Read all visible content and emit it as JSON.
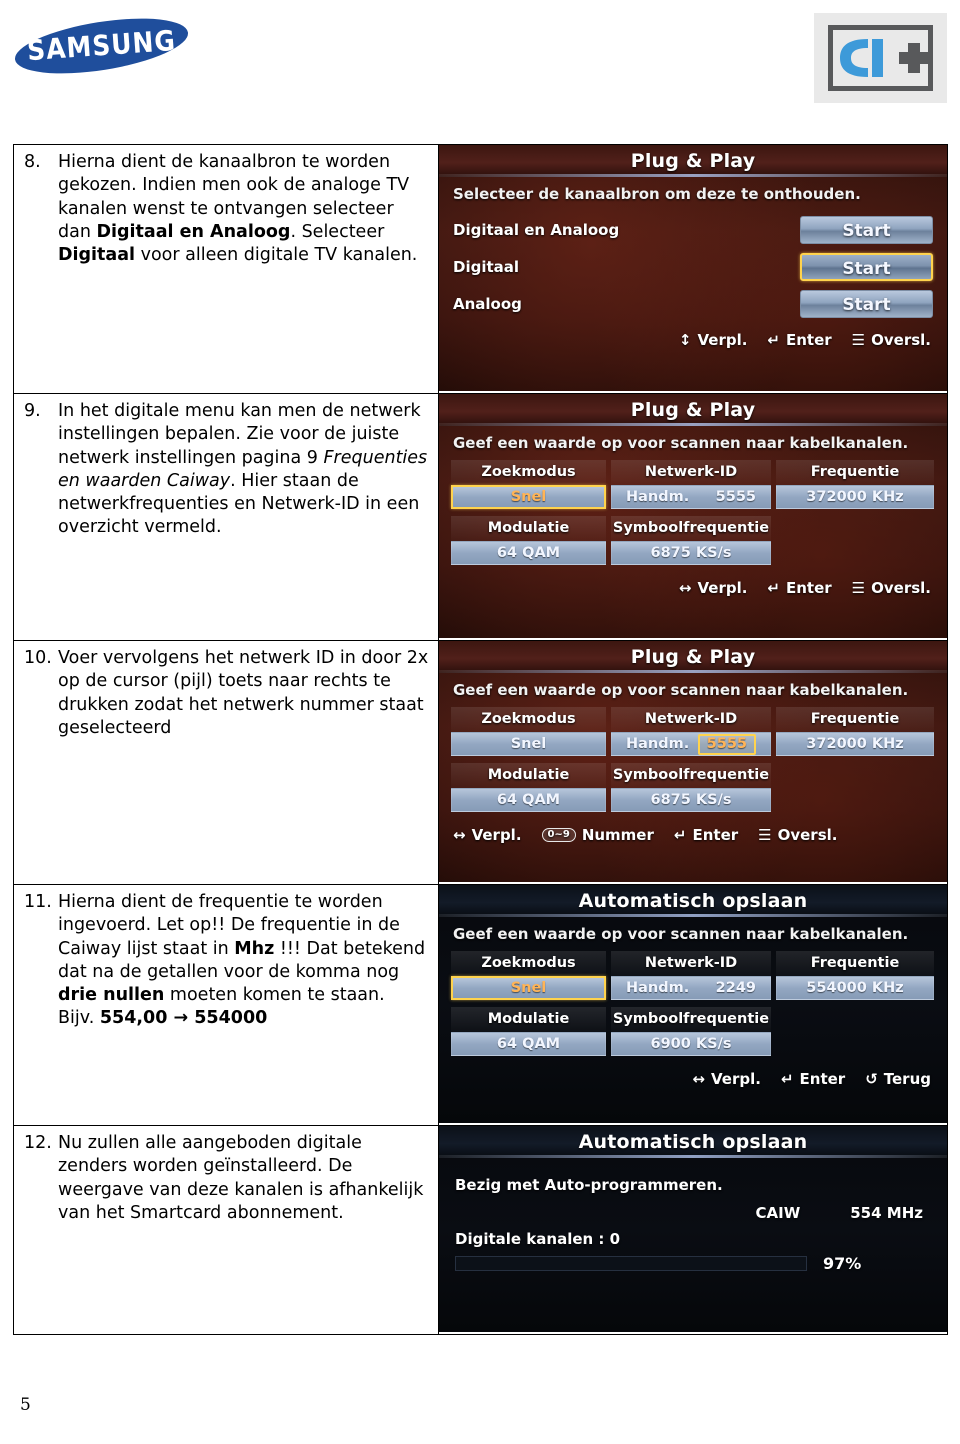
{
  "header": {
    "brand_logo": "samsung-logo",
    "brand_text": "SAMSUNG",
    "certification_logo": "ci-plus-logo",
    "certification_text": "CI+"
  },
  "page_number": "5",
  "steps": [
    {
      "number": "8.",
      "text_parts": [
        {
          "t": "Hierna dient de kanaalbron te worden gekozen. Indien men ook de analoge TV kanalen wenst te ontvangen selecteer dan ",
          "style": "normal"
        },
        {
          "t": "Digitaal en Analoog",
          "style": "bold"
        },
        {
          "t": ". Selecteer ",
          "style": "normal"
        },
        {
          "t": "Digitaal",
          "style": "bold"
        },
        {
          "t": " voor alleen digitale TV kanalen.",
          "style": "normal"
        }
      ]
    },
    {
      "number": "9.",
      "text_parts": [
        {
          "t": "In het digitale menu kan men de netwerk instellingen bepalen. Zie voor de juiste netwerk instellingen pagina 9 ",
          "style": "normal"
        },
        {
          "t": "Frequenties en waarden Caiway",
          "style": "italic"
        },
        {
          "t": ". Hier staan de netwerkfrequenties en Netwerk-ID in een overzicht vermeld.",
          "style": "normal"
        }
      ]
    },
    {
      "number": "10.",
      "text_parts": [
        {
          "t": "Voer vervolgens het netwerk ID in door 2x op de cursor (pijl) toets naar rechts te drukken zodat het netwerk nummer staat geselecteerd",
          "style": "normal"
        }
      ]
    },
    {
      "number": "11.",
      "text_parts": [
        {
          "t": "Hierna dient de frequentie te worden ingevoerd. Let op!! De frequentie in de Caiway lijst staat in ",
          "style": "normal"
        },
        {
          "t": "Mhz",
          "style": "bold"
        },
        {
          "t": " !!! Dat betekend dat na de getallen voor de komma nog ",
          "style": "normal"
        },
        {
          "t": "drie nullen",
          "style": "bold"
        },
        {
          "t": " moeten komen te staan.",
          "style": "normal"
        },
        {
          "t": "\nBijv. ",
          "style": "normal"
        },
        {
          "t": "554,00 → 554000",
          "style": "bold"
        }
      ]
    },
    {
      "number": "12.",
      "text_parts": [
        {
          "t": "Nu zullen alle aangeboden digitale zenders worden geïnstalleerd. De weergave van deze kanalen is afhankelijk van het Smartcard abonnement.",
          "style": "normal"
        }
      ]
    }
  ],
  "screens": [
    {
      "id": "plug-play-source",
      "title": "Plug & Play",
      "subtitle": "Selecteer de kanaalbron om deze te onthouden.",
      "options": [
        {
          "label": "Digitaal en Analoog",
          "button": "Start",
          "selected": false
        },
        {
          "label": "Digitaal",
          "button": "Start",
          "selected": true
        },
        {
          "label": "Analoog",
          "button": "Start",
          "selected": false
        }
      ],
      "hints": [
        {
          "icon": "up-down-arrow-icon",
          "glyph": "↕",
          "label": "Verpl."
        },
        {
          "icon": "enter-key-icon",
          "glyph": "↵",
          "label": "Enter"
        },
        {
          "icon": "exit-icon",
          "glyph": "☰",
          "label": "Oversl."
        }
      ]
    },
    {
      "id": "plug-play-values-1",
      "title": "Plug & Play",
      "subtitle": "Geef een waarde op voor scannen naar kabelkanalen.",
      "fields": {
        "zoekmodus_label": "Zoekmodus",
        "zoekmodus_value": "Snel",
        "netwerk_id_label": "Netwerk-ID",
        "netwerk_id_mode": "Handm.",
        "netwerk_id_value": "5555",
        "frequentie_label": "Frequentie",
        "frequentie_value": "372000 KHz",
        "modulatie_label": "Modulatie",
        "modulatie_value": "64  QAM",
        "symbool_label": "Symboolfrequentie",
        "symbool_value": "6875 KS/s"
      },
      "highlight": "zoekmodus",
      "hints": [
        {
          "icon": "left-right-arrow-icon",
          "glyph": "↔",
          "label": "Verpl."
        },
        {
          "icon": "enter-key-icon",
          "glyph": "↵",
          "label": "Enter"
        },
        {
          "icon": "exit-icon",
          "glyph": "☰",
          "label": "Oversl."
        }
      ]
    },
    {
      "id": "plug-play-values-2",
      "title": "Plug & Play",
      "subtitle": "Geef een waarde op voor scannen naar kabelkanalen.",
      "fields": {
        "zoekmodus_label": "Zoekmodus",
        "zoekmodus_value": "Snel",
        "netwerk_id_label": "Netwerk-ID",
        "netwerk_id_mode": "Handm.",
        "netwerk_id_value": "5555",
        "frequentie_label": "Frequentie",
        "frequentie_value": "372000 KHz",
        "modulatie_label": "Modulatie",
        "modulatie_value": "64  QAM",
        "symbool_label": "Symboolfrequentie",
        "symbool_value": "6875 KS/s"
      },
      "highlight": "netwerk-id-number",
      "hints": [
        {
          "icon": "left-right-arrow-icon",
          "glyph": "↔",
          "label": "Verpl."
        },
        {
          "icon": "number-keys-icon",
          "glyph": "0~9",
          "label": "Nummer"
        },
        {
          "icon": "enter-key-icon",
          "glyph": "↵",
          "label": "Enter"
        },
        {
          "icon": "exit-icon",
          "glyph": "☰",
          "label": "Oversl."
        }
      ]
    },
    {
      "id": "auto-store-values",
      "title": "Automatisch opslaan",
      "subtitle": "Geef een waarde op voor scannen naar kabelkanalen.",
      "fields": {
        "zoekmodus_label": "Zoekmodus",
        "zoekmodus_value": "Snel",
        "netwerk_id_label": "Netwerk-ID",
        "netwerk_id_mode": "Handm.",
        "netwerk_id_value": "2249",
        "frequentie_label": "Frequentie",
        "frequentie_value": "554000 KHz",
        "modulatie_label": "Modulatie",
        "modulatie_value": "64  QAM",
        "symbool_label": "Symboolfrequentie",
        "symbool_value": "6900 KS/s"
      },
      "highlight": "zoekmodus",
      "hints": [
        {
          "icon": "left-right-arrow-icon",
          "glyph": "↔",
          "label": "Verpl."
        },
        {
          "icon": "enter-key-icon",
          "glyph": "↵",
          "label": "Enter"
        },
        {
          "icon": "back-icon",
          "glyph": "↺",
          "label": "Terug"
        }
      ]
    },
    {
      "id": "auto-store-progress",
      "title": "Automatisch opslaan",
      "subtitle": "Bezig met Auto-programmeren.",
      "provider": "CAIW",
      "frequency": "554 MHz",
      "channels_label": "Digitale kanalen : 0",
      "progress_percent": "97%",
      "progress_value": 97
    }
  ]
}
